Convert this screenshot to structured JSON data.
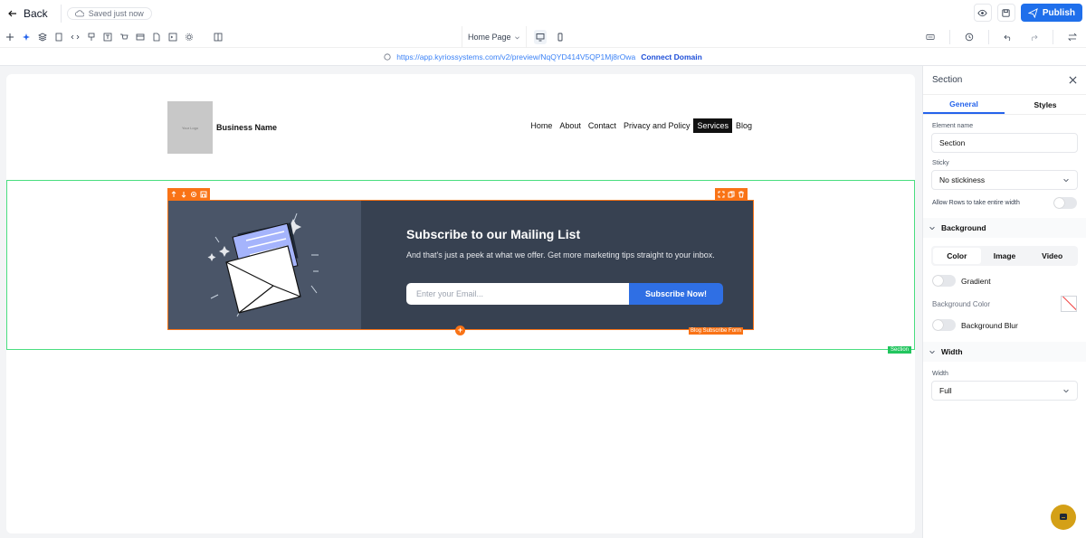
{
  "topbar": {
    "back_label": "Back",
    "saved_status": "Saved just now",
    "publish_label": "Publish"
  },
  "toolbar": {
    "page_name": "Home Page",
    "tool_icons": [
      "plus-icon",
      "sparkle-icon",
      "layers-icon",
      "page-icon",
      "code-icon",
      "paint-icon",
      "text-icon",
      "cart-icon",
      "browser-icon",
      "file-icon",
      "terminal-icon",
      "settings-icon",
      "columns-icon"
    ]
  },
  "urlbar": {
    "url": "https://app.kyriossystems.com/v2/preview/NqQYD414V5QP1Mj8rOwa",
    "connect_label": "Connect Domain"
  },
  "site": {
    "logo_placeholder": "Your Logo",
    "business_name": "Business Name",
    "nav": [
      "Home",
      "About",
      "Contact",
      "Privacy and Policy",
      "Services",
      "Blog"
    ],
    "active_nav": "Services"
  },
  "subscribe": {
    "title": "Subscribe to our Mailing List",
    "description": "And that's just a peek at what we offer. Get more marketing tips straight to your inbox.",
    "email_placeholder": "Enter your Email...",
    "button_label": "Subscribe Now!",
    "element_tag": "Blog Subscribe Form",
    "section_tag": "Section",
    "add_symbol": "+"
  },
  "panel": {
    "title": "Section",
    "tabs": [
      "General",
      "Styles"
    ],
    "element_name_label": "Element name",
    "element_name_value": "Section",
    "sticky_label": "Sticky",
    "sticky_value": "No stickiness",
    "allow_rows_label": "Allow Rows to take entire width",
    "background_heading": "Background",
    "bg_tabs": [
      "Color",
      "Image",
      "Video"
    ],
    "gradient_label": "Gradient",
    "bg_color_label": "Background Color",
    "bg_blur_label": "Background Blur",
    "width_heading": "Width",
    "width_label": "Width",
    "width_value": "Full"
  },
  "colors": {
    "accent": "#1f6feb",
    "selection": "#f97316",
    "section_outline": "#4ade80",
    "subscribe_bg": "#374151",
    "subscribe_left": "#4a5568",
    "chat": "#d4a017"
  }
}
